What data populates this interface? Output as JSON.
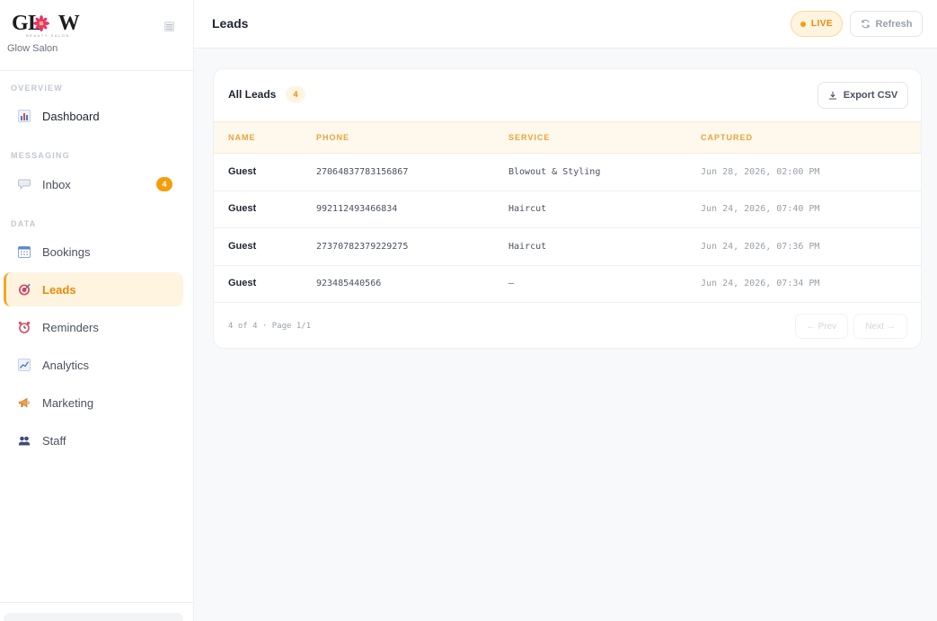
{
  "brand": {
    "logo_text": "GLOW",
    "logo_tagline": "BEAUTY SALON",
    "salon_name": "Glow Salon",
    "accent": "#f59e0b",
    "flower_color": "#e8336e"
  },
  "sidebar": {
    "sections": {
      "overview": "OVERVIEW",
      "messaging": "MESSAGING",
      "data": "DATA"
    },
    "items": [
      {
        "label": "Dashboard",
        "icon": "bar-chart-icon"
      },
      {
        "label": "Inbox",
        "icon": "speech-bubble-icon",
        "badge": "4"
      },
      {
        "label": "Bookings",
        "icon": "calendar-icon"
      },
      {
        "label": "Leads",
        "icon": "target-icon",
        "active": true
      },
      {
        "label": "Reminders",
        "icon": "alarm-clock-icon"
      },
      {
        "label": "Analytics",
        "icon": "chart-up-icon"
      },
      {
        "label": "Marketing",
        "icon": "megaphone-icon"
      },
      {
        "label": "Staff",
        "icon": "people-icon"
      }
    ]
  },
  "header": {
    "title": "Leads",
    "live_label": "LIVE",
    "refresh_label": "Refresh"
  },
  "leads_card": {
    "title": "All Leads",
    "count": "4",
    "export_label": "Export CSV",
    "columns": [
      "NAME",
      "PHONE",
      "SERVICE",
      "CAPTURED"
    ],
    "rows": [
      {
        "name": "Guest",
        "phone": "27064837783156867",
        "service": "Blowout & Styling",
        "captured": "Jun 28, 2026, 02:00 PM"
      },
      {
        "name": "Guest",
        "phone": "992112493466834",
        "service": "Haircut",
        "captured": "Jun 24, 2026, 07:40 PM"
      },
      {
        "name": "Guest",
        "phone": "27370782379229275",
        "service": "Haircut",
        "captured": "Jun 24, 2026, 07:36 PM"
      },
      {
        "name": "Guest",
        "phone": "923485440566",
        "service": "—",
        "captured": "Jun 24, 2026, 07:34 PM"
      }
    ],
    "pager_text": "4 of 4 · Page 1/1",
    "prev_label": "← Prev",
    "next_label": "Next →"
  }
}
